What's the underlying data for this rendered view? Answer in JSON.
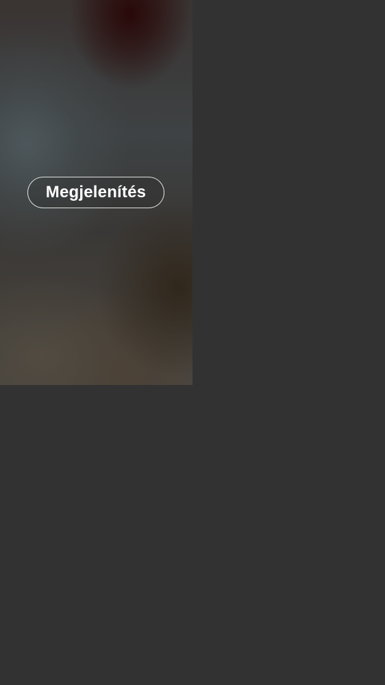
{
  "media": {
    "show_button_label": "Megjelenítés"
  },
  "colors": {
    "background": "#323232",
    "button_text": "#ffffff",
    "button_border": "#ffffff"
  }
}
